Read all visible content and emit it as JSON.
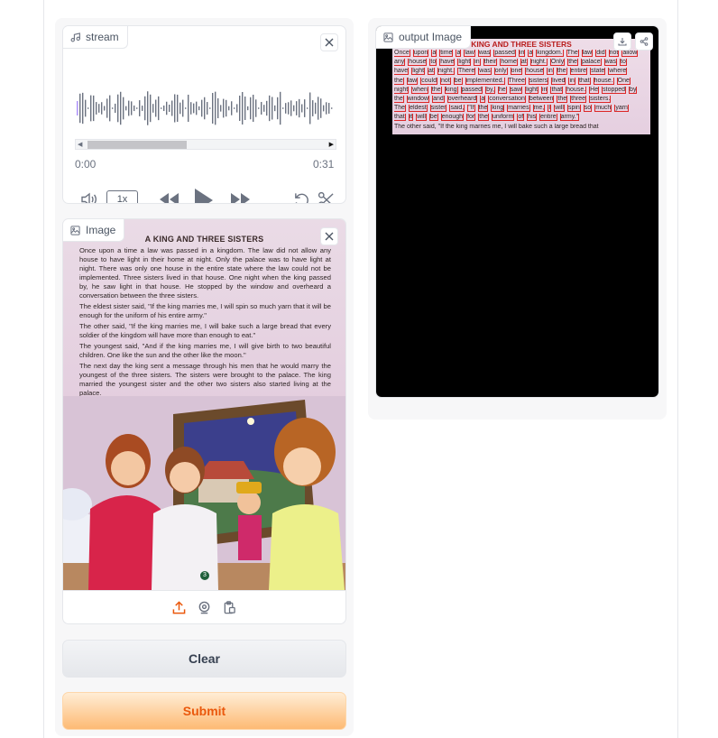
{
  "audio": {
    "label": "stream",
    "current_time": "0:00",
    "duration": "0:31",
    "playback_rate": "1x",
    "scroll_position": 0.42
  },
  "input_image": {
    "label": "Image",
    "story_title": "A KING AND THREE SISTERS",
    "paragraphs": [
      "Once upon a time a law was passed in a kingdom. The law did not allow any house to have light in their home at night. Only the palace was to have light at night. There was only one house in the entire state where the law could not be implemented. Three sisters lived in that house. One night when the king passed by, he saw light in that house. He stopped by the window and overheard a conversation between the three sisters.",
      "The eldest sister said, \"If the king marries me, I will spin so much yarn that it will be enough for the uniform of his entire army.\"",
      "The other said, \"If the king marries me, I will bake such a large bread that every soldier of the kingdom will have more than enough to eat.\"",
      "The youngest said, \"And if the king marries me, I will give birth to two beautiful children. One like the sun and the other like the moon.\"",
      "The next day the king sent a message through his men that he would marry the youngest of the three sisters. The sisters were brought to the palace. The king married the youngest sister and the other two sisters also started living at the palace."
    ],
    "page_number": "3"
  },
  "output_image": {
    "label": "output Image",
    "story_title": "KING AND THREE SISTERS",
    "lines": [
      [
        "Once",
        "upon",
        "a",
        "time",
        "a",
        "law",
        "was",
        "passed",
        "in",
        "a",
        "kingdom.",
        "The",
        "law",
        "did",
        "not",
        "allow"
      ],
      [
        "any",
        "house",
        "to",
        "have",
        "light",
        "in",
        "their",
        "home",
        "at",
        "night.",
        "Only",
        "the",
        "palace",
        "was",
        "to"
      ],
      [
        "have",
        "light",
        "at",
        "night.",
        "There",
        "was",
        "only",
        "one",
        "house",
        "in",
        "the",
        "entire",
        "state",
        "where"
      ],
      [
        "the",
        "law",
        "could",
        "not",
        "be",
        "implemented.",
        "Three",
        "sisters",
        "lived",
        "in",
        "that",
        "house.",
        "One"
      ],
      [
        "night",
        "when",
        "the",
        "king",
        "passed",
        "by,",
        "he",
        "saw",
        "light",
        "in",
        "that",
        "house.",
        "He",
        "stopped",
        "by"
      ],
      [
        "the",
        "window",
        "and",
        "overheard",
        "a",
        "conversation",
        "between",
        "the",
        "three",
        "sisters."
      ],
      [
        "The",
        "eldest",
        "sister",
        "said,",
        "\"If",
        "the",
        "king",
        "marries",
        "me,",
        "I",
        "will",
        "spin",
        "so",
        "much",
        "yarn"
      ],
      [
        "that",
        "it",
        "will",
        "be",
        "enough",
        "for",
        "the",
        "uniform",
        "of",
        "his",
        "entire",
        "army.\""
      ],
      [
        "The other said, \"If the king marries me, I will bake such a large bread that"
      ]
    ]
  },
  "buttons": {
    "clear": "Clear",
    "submit": "Submit"
  },
  "colors": {
    "submit_text": "#ea580c",
    "ocr_box": "#dc2626"
  }
}
